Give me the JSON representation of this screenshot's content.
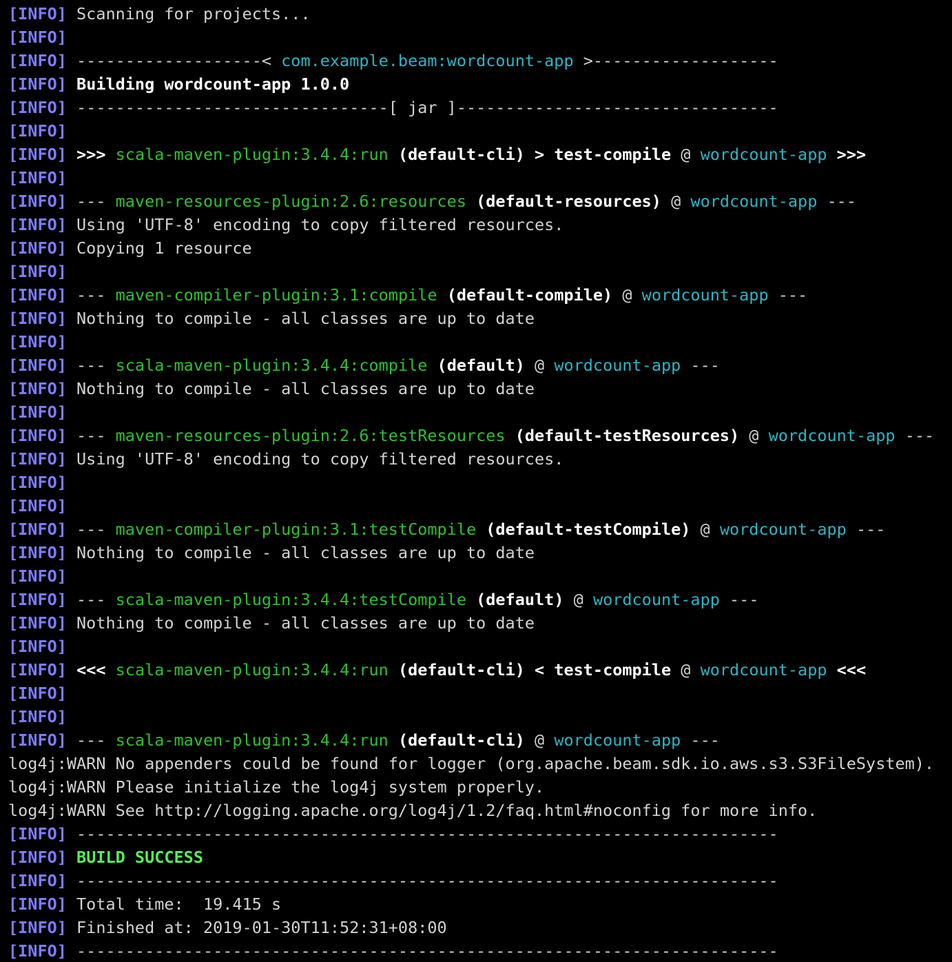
{
  "colors": {
    "background": "#000000",
    "info_tag": "#7d7dff",
    "text": "#d2d2d2",
    "bold_text": "#ffffff",
    "plugin_green": "#2fc02f",
    "artifact_cyan": "#2cb5c6",
    "success_green": "#57ef57"
  },
  "terminal": {
    "lines": [
      [
        {
          "t": "[INFO]",
          "s": "tag"
        },
        {
          "t": " Scanning for projects...",
          "s": "plain"
        }
      ],
      [
        {
          "t": "[INFO]",
          "s": "tag"
        }
      ],
      [
        {
          "t": "[INFO]",
          "s": "tag"
        },
        {
          "t": " -------------------< ",
          "s": "plain"
        },
        {
          "t": "com.example.beam:wordcount-app",
          "s": "cyan"
        },
        {
          "t": " >-------------------",
          "s": "plain"
        }
      ],
      [
        {
          "t": "[INFO]",
          "s": "tag"
        },
        {
          "t": " ",
          "s": "plain"
        },
        {
          "t": "Building wordcount-app 1.0.0",
          "s": "bold"
        }
      ],
      [
        {
          "t": "[INFO]",
          "s": "tag"
        },
        {
          "t": " --------------------------------[ jar ]---------------------------------",
          "s": "plain"
        }
      ],
      [
        {
          "t": "[INFO]",
          "s": "tag"
        }
      ],
      [
        {
          "t": "[INFO]",
          "s": "tag"
        },
        {
          "t": " ",
          "s": "plain"
        },
        {
          "t": ">>>",
          "s": "bold"
        },
        {
          "t": " ",
          "s": "plain"
        },
        {
          "t": "scala-maven-plugin:3.4.4:run",
          "s": "green"
        },
        {
          "t": " ",
          "s": "plain"
        },
        {
          "t": "(default-cli) > test-compile",
          "s": "bold"
        },
        {
          "t": " @ ",
          "s": "plain"
        },
        {
          "t": "wordcount-app",
          "s": "cyan"
        },
        {
          "t": " ",
          "s": "plain"
        },
        {
          "t": ">>>",
          "s": "bold"
        }
      ],
      [
        {
          "t": "[INFO]",
          "s": "tag"
        }
      ],
      [
        {
          "t": "[INFO]",
          "s": "tag"
        },
        {
          "t": " --- ",
          "s": "plain"
        },
        {
          "t": "maven-resources-plugin:2.6:resources",
          "s": "green"
        },
        {
          "t": " ",
          "s": "plain"
        },
        {
          "t": "(default-resources)",
          "s": "bold"
        },
        {
          "t": " @ ",
          "s": "plain"
        },
        {
          "t": "wordcount-app",
          "s": "cyan"
        },
        {
          "t": " ---",
          "s": "plain"
        }
      ],
      [
        {
          "t": "[INFO]",
          "s": "tag"
        },
        {
          "t": " Using 'UTF-8' encoding to copy filtered resources.",
          "s": "plain"
        }
      ],
      [
        {
          "t": "[INFO]",
          "s": "tag"
        },
        {
          "t": " Copying 1 resource",
          "s": "plain"
        }
      ],
      [
        {
          "t": "[INFO]",
          "s": "tag"
        }
      ],
      [
        {
          "t": "[INFO]",
          "s": "tag"
        },
        {
          "t": " --- ",
          "s": "plain"
        },
        {
          "t": "maven-compiler-plugin:3.1:compile",
          "s": "green"
        },
        {
          "t": " ",
          "s": "plain"
        },
        {
          "t": "(default-compile)",
          "s": "bold"
        },
        {
          "t": " @ ",
          "s": "plain"
        },
        {
          "t": "wordcount-app",
          "s": "cyan"
        },
        {
          "t": " ---",
          "s": "plain"
        }
      ],
      [
        {
          "t": "[INFO]",
          "s": "tag"
        },
        {
          "t": " Nothing to compile - all classes are up to date",
          "s": "plain"
        }
      ],
      [
        {
          "t": "[INFO]",
          "s": "tag"
        }
      ],
      [
        {
          "t": "[INFO]",
          "s": "tag"
        },
        {
          "t": " --- ",
          "s": "plain"
        },
        {
          "t": "scala-maven-plugin:3.4.4:compile",
          "s": "green"
        },
        {
          "t": " ",
          "s": "plain"
        },
        {
          "t": "(default)",
          "s": "bold"
        },
        {
          "t": " @ ",
          "s": "plain"
        },
        {
          "t": "wordcount-app",
          "s": "cyan"
        },
        {
          "t": " ---",
          "s": "plain"
        }
      ],
      [
        {
          "t": "[INFO]",
          "s": "tag"
        },
        {
          "t": " Nothing to compile - all classes are up to date",
          "s": "plain"
        }
      ],
      [
        {
          "t": "[INFO]",
          "s": "tag"
        }
      ],
      [
        {
          "t": "[INFO]",
          "s": "tag"
        },
        {
          "t": " --- ",
          "s": "plain"
        },
        {
          "t": "maven-resources-plugin:2.6:testResources",
          "s": "green"
        },
        {
          "t": " ",
          "s": "plain"
        },
        {
          "t": "(default-testResources)",
          "s": "bold"
        },
        {
          "t": " @ ",
          "s": "plain"
        },
        {
          "t": "wordcount-app",
          "s": "cyan"
        },
        {
          "t": " ---",
          "s": "plain"
        }
      ],
      [
        {
          "t": "[INFO]",
          "s": "tag"
        },
        {
          "t": " Using 'UTF-8' encoding to copy filtered resources.",
          "s": "plain"
        }
      ],
      [
        {
          "t": "[INFO]",
          "s": "tag"
        }
      ],
      [
        {
          "t": "[INFO]",
          "s": "tag"
        }
      ],
      [
        {
          "t": "[INFO]",
          "s": "tag"
        },
        {
          "t": " --- ",
          "s": "plain"
        },
        {
          "t": "maven-compiler-plugin:3.1:testCompile",
          "s": "green"
        },
        {
          "t": " ",
          "s": "plain"
        },
        {
          "t": "(default-testCompile)",
          "s": "bold"
        },
        {
          "t": " @ ",
          "s": "plain"
        },
        {
          "t": "wordcount-app",
          "s": "cyan"
        },
        {
          "t": " ---",
          "s": "plain"
        }
      ],
      [
        {
          "t": "[INFO]",
          "s": "tag"
        },
        {
          "t": " Nothing to compile - all classes are up to date",
          "s": "plain"
        }
      ],
      [
        {
          "t": "[INFO]",
          "s": "tag"
        }
      ],
      [
        {
          "t": "[INFO]",
          "s": "tag"
        },
        {
          "t": " --- ",
          "s": "plain"
        },
        {
          "t": "scala-maven-plugin:3.4.4:testCompile",
          "s": "green"
        },
        {
          "t": " ",
          "s": "plain"
        },
        {
          "t": "(default)",
          "s": "bold"
        },
        {
          "t": " @ ",
          "s": "plain"
        },
        {
          "t": "wordcount-app",
          "s": "cyan"
        },
        {
          "t": " ---",
          "s": "plain"
        }
      ],
      [
        {
          "t": "[INFO]",
          "s": "tag"
        },
        {
          "t": " Nothing to compile - all classes are up to date",
          "s": "plain"
        }
      ],
      [
        {
          "t": "[INFO]",
          "s": "tag"
        }
      ],
      [
        {
          "t": "[INFO]",
          "s": "tag"
        },
        {
          "t": " ",
          "s": "plain"
        },
        {
          "t": "<<<",
          "s": "bold"
        },
        {
          "t": " ",
          "s": "plain"
        },
        {
          "t": "scala-maven-plugin:3.4.4:run",
          "s": "green"
        },
        {
          "t": " ",
          "s": "plain"
        },
        {
          "t": "(default-cli) < test-compile",
          "s": "bold"
        },
        {
          "t": " @ ",
          "s": "plain"
        },
        {
          "t": "wordcount-app",
          "s": "cyan"
        },
        {
          "t": " ",
          "s": "plain"
        },
        {
          "t": "<<<",
          "s": "bold"
        }
      ],
      [
        {
          "t": "[INFO]",
          "s": "tag"
        }
      ],
      [
        {
          "t": "[INFO]",
          "s": "tag"
        }
      ],
      [
        {
          "t": "[INFO]",
          "s": "tag"
        },
        {
          "t": " --- ",
          "s": "plain"
        },
        {
          "t": "scala-maven-plugin:3.4.4:run",
          "s": "green"
        },
        {
          "t": " ",
          "s": "plain"
        },
        {
          "t": "(default-cli)",
          "s": "bold"
        },
        {
          "t": " @ ",
          "s": "plain"
        },
        {
          "t": "wordcount-app",
          "s": "cyan"
        },
        {
          "t": " ---",
          "s": "plain"
        }
      ],
      [
        {
          "t": "log4j:WARN No appenders could be found for logger (org.apache.beam.sdk.io.aws.s3.S3FileSystem).",
          "s": "plain"
        }
      ],
      [
        {
          "t": "log4j:WARN Please initialize the log4j system properly.",
          "s": "plain"
        }
      ],
      [
        {
          "t": "log4j:WARN See http://logging.apache.org/log4j/1.2/faq.html#noconfig for more info.",
          "s": "plain"
        }
      ],
      [
        {
          "t": "[INFO]",
          "s": "tag"
        },
        {
          "t": " ------------------------------------------------------------------------",
          "s": "plain"
        }
      ],
      [
        {
          "t": "[INFO]",
          "s": "tag"
        },
        {
          "t": " ",
          "s": "plain"
        },
        {
          "t": "BUILD SUCCESS",
          "s": "success"
        }
      ],
      [
        {
          "t": "[INFO]",
          "s": "tag"
        },
        {
          "t": " ------------------------------------------------------------------------",
          "s": "plain"
        }
      ],
      [
        {
          "t": "[INFO]",
          "s": "tag"
        },
        {
          "t": " Total time:  19.415 s",
          "s": "plain"
        }
      ],
      [
        {
          "t": "[INFO]",
          "s": "tag"
        },
        {
          "t": " Finished at: 2019-01-30T11:52:31+08:00",
          "s": "plain"
        }
      ],
      [
        {
          "t": "[INFO]",
          "s": "tag"
        },
        {
          "t": " ------------------------------------------------------------------------",
          "s": "plain"
        }
      ]
    ]
  }
}
